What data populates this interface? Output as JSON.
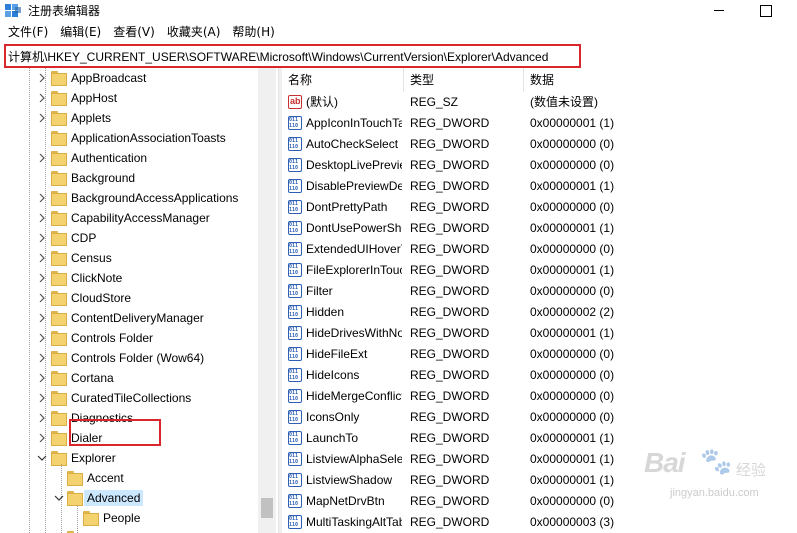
{
  "window": {
    "title": "注册表编辑器"
  },
  "menu": [
    {
      "label": "文件(F)"
    },
    {
      "label": "编辑(E)"
    },
    {
      "label": "查看(V)"
    },
    {
      "label": "收藏夹(A)"
    },
    {
      "label": "帮助(H)"
    }
  ],
  "address": {
    "path": "计算机\\HKEY_CURRENT_USER\\SOFTWARE\\Microsoft\\Windows\\CurrentVersion\\Explorer\\Advanced"
  },
  "tree": {
    "items": [
      {
        "label": "AppBroadcast",
        "state": "collapsed"
      },
      {
        "label": "AppHost",
        "state": "collapsed"
      },
      {
        "label": "Applets",
        "state": "collapsed"
      },
      {
        "label": "ApplicationAssociationToasts",
        "state": "none"
      },
      {
        "label": "Authentication",
        "state": "collapsed"
      },
      {
        "label": "Background",
        "state": "none"
      },
      {
        "label": "BackgroundAccessApplications",
        "state": "collapsed"
      },
      {
        "label": "CapabilityAccessManager",
        "state": "collapsed"
      },
      {
        "label": "CDP",
        "state": "collapsed"
      },
      {
        "label": "Census",
        "state": "collapsed"
      },
      {
        "label": "ClickNote",
        "state": "collapsed"
      },
      {
        "label": "CloudStore",
        "state": "collapsed"
      },
      {
        "label": "ContentDeliveryManager",
        "state": "collapsed"
      },
      {
        "label": "Controls Folder",
        "state": "collapsed"
      },
      {
        "label": "Controls Folder (Wow64)",
        "state": "collapsed"
      },
      {
        "label": "Cortana",
        "state": "collapsed"
      },
      {
        "label": "CuratedTileCollections",
        "state": "collapsed"
      },
      {
        "label": "Diagnostics",
        "state": "collapsed"
      },
      {
        "label": "Dialer",
        "state": "collapsed"
      },
      {
        "label": "Explorer",
        "state": "expanded"
      },
      {
        "label": "Accent",
        "state": "none",
        "level": 1
      },
      {
        "label": "Advanced",
        "state": "expanded",
        "level": 1,
        "selected": true
      },
      {
        "label": "People",
        "state": "none",
        "level": 2
      }
    ]
  },
  "values": {
    "columns": {
      "name": "名称",
      "type": "类型",
      "data": "数据"
    },
    "rows": [
      {
        "name": "(默认)",
        "type": "REG_SZ",
        "data": "(数值未设置)",
        "icon": "string-value-icon"
      },
      {
        "name": "AppIconInTouchTaskbar",
        "type": "REG_DWORD",
        "data": "0x00000001 (1)",
        "icon": "dword-value-icon"
      },
      {
        "name": "AutoCheckSelect",
        "type": "REG_DWORD",
        "data": "0x00000000 (0)",
        "icon": "dword-value-icon"
      },
      {
        "name": "DesktopLivePreviewHoverTime",
        "type": "REG_DWORD",
        "data": "0x00000000 (0)",
        "icon": "dword-value-icon"
      },
      {
        "name": "DisablePreviewDesktop",
        "type": "REG_DWORD",
        "data": "0x00000001 (1)",
        "icon": "dword-value-icon"
      },
      {
        "name": "DontPrettyPath",
        "type": "REG_DWORD",
        "data": "0x00000000 (0)",
        "icon": "dword-value-icon"
      },
      {
        "name": "DontUsePowerShellOnWinX",
        "type": "REG_DWORD",
        "data": "0x00000001 (1)",
        "icon": "dword-value-icon"
      },
      {
        "name": "ExtendedUIHoverTime",
        "type": "REG_DWORD",
        "data": "0x00000000 (0)",
        "icon": "dword-value-icon"
      },
      {
        "name": "FileExplorerInTouchImprovement",
        "type": "REG_DWORD",
        "data": "0x00000001 (1)",
        "icon": "dword-value-icon"
      },
      {
        "name": "Filter",
        "type": "REG_DWORD",
        "data": "0x00000000 (0)",
        "icon": "dword-value-icon"
      },
      {
        "name": "Hidden",
        "type": "REG_DWORD",
        "data": "0x00000002 (2)",
        "icon": "dword-value-icon"
      },
      {
        "name": "HideDrivesWithNoMedia",
        "type": "REG_DWORD",
        "data": "0x00000001 (1)",
        "icon": "dword-value-icon"
      },
      {
        "name": "HideFileExt",
        "type": "REG_DWORD",
        "data": "0x00000000 (0)",
        "icon": "dword-value-icon"
      },
      {
        "name": "HideIcons",
        "type": "REG_DWORD",
        "data": "0x00000000 (0)",
        "icon": "dword-value-icon"
      },
      {
        "name": "HideMergeConflicts",
        "type": "REG_DWORD",
        "data": "0x00000000 (0)",
        "icon": "dword-value-icon"
      },
      {
        "name": "IconsOnly",
        "type": "REG_DWORD",
        "data": "0x00000000 (0)",
        "icon": "dword-value-icon"
      },
      {
        "name": "LaunchTo",
        "type": "REG_DWORD",
        "data": "0x00000001 (1)",
        "icon": "dword-value-icon"
      },
      {
        "name": "ListviewAlphaSelect",
        "type": "REG_DWORD",
        "data": "0x00000001 (1)",
        "icon": "dword-value-icon"
      },
      {
        "name": "ListviewShadow",
        "type": "REG_DWORD",
        "data": "0x00000001 (1)",
        "icon": "dword-value-icon"
      },
      {
        "name": "MapNetDrvBtn",
        "type": "REG_DWORD",
        "data": "0x00000000 (0)",
        "icon": "dword-value-icon"
      },
      {
        "name": "MultiTaskingAltTabFilter",
        "type": "REG_DWORD",
        "data": "0x00000003 (3)",
        "icon": "dword-value-icon"
      }
    ]
  },
  "watermark": {
    "brand": "Bai",
    "brand2": "经验",
    "url": "jingyan.baidu.com"
  }
}
